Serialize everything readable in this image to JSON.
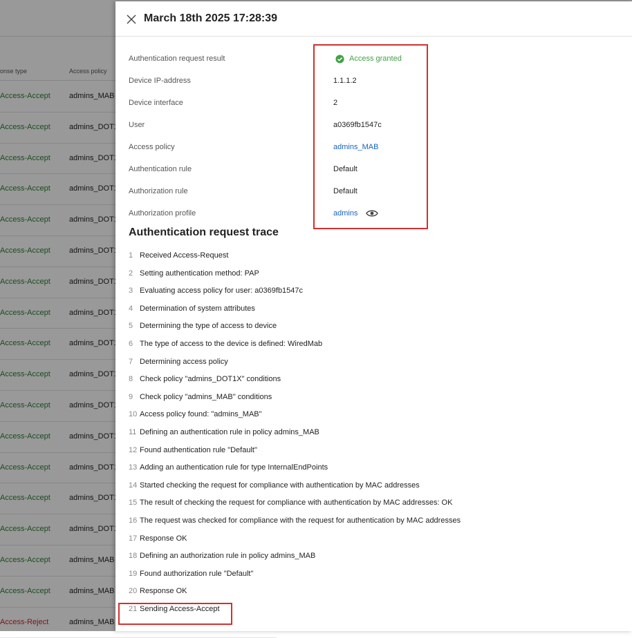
{
  "background": {
    "columns": {
      "response_type": "onse type",
      "access_policy": "Access policy"
    },
    "rows": [
      {
        "response": "Access-Accept",
        "policy": "admins_MAB",
        "status": "accept"
      },
      {
        "response": "Access-Accept",
        "policy": "admins_DOT1",
        "status": "accept"
      },
      {
        "response": "Access-Accept",
        "policy": "admins_DOT1",
        "status": "accept"
      },
      {
        "response": "Access-Accept",
        "policy": "admins_DOT1",
        "status": "accept"
      },
      {
        "response": "Access-Accept",
        "policy": "admins_DOT1",
        "status": "accept"
      },
      {
        "response": "Access-Accept",
        "policy": "admins_DOT1",
        "status": "accept"
      },
      {
        "response": "Access-Accept",
        "policy": "admins_DOT1",
        "status": "accept"
      },
      {
        "response": "Access-Accept",
        "policy": "admins_DOT1",
        "status": "accept"
      },
      {
        "response": "Access-Accept",
        "policy": "admins_DOT1",
        "status": "accept"
      },
      {
        "response": "Access-Accept",
        "policy": "admins_DOT1",
        "status": "accept"
      },
      {
        "response": "Access-Accept",
        "policy": "admins_DOT1",
        "status": "accept"
      },
      {
        "response": "Access-Accept",
        "policy": "admins_DOT1",
        "status": "accept"
      },
      {
        "response": "Access-Accept",
        "policy": "admins_DOT1",
        "status": "accept"
      },
      {
        "response": "Access-Accept",
        "policy": "admins_DOT1",
        "status": "accept"
      },
      {
        "response": "Access-Accept",
        "policy": "admins_DOT1",
        "status": "accept"
      },
      {
        "response": "Access-Accept",
        "policy": "admins_MAB",
        "status": "accept"
      },
      {
        "response": "Access-Accept",
        "policy": "admins_MAB",
        "status": "accept"
      },
      {
        "response": "Access-Reject",
        "policy": "admins_MAB",
        "status": "reject"
      }
    ]
  },
  "drawer": {
    "title": "March 18th 2025 17:28:39",
    "fields": {
      "result_label": "Authentication request result",
      "result_value": "Access granted",
      "ip_label": "Device IP-address",
      "ip_value": "1.1.1.2",
      "interface_label": "Device interface",
      "interface_value": "2",
      "user_label": "User",
      "user_value": "a0369fb1547c",
      "policy_label": "Access policy",
      "policy_value": "admins_MAB",
      "auth_rule_label": "Authentication rule",
      "auth_rule_value": "Default",
      "authz_rule_label": "Authorization rule",
      "authz_rule_value": "Default",
      "profile_label": "Authorization profile",
      "profile_value": "admins"
    },
    "trace_title": "Authentication request trace",
    "trace": [
      {
        "n": "1",
        "text": "Received Access-Request"
      },
      {
        "n": "2",
        "text": "Setting authentication method: PAP"
      },
      {
        "n": "3",
        "text": "Evaluating access policy for user: a0369fb1547c"
      },
      {
        "n": "4",
        "text": "Determination of system attributes"
      },
      {
        "n": "5",
        "text": "Determining the type of access to device"
      },
      {
        "n": "6",
        "text": "The type of access to the device is defined: WiredMab"
      },
      {
        "n": "7",
        "text": "Determining access policy"
      },
      {
        "n": "8",
        "text": "Check policy \"admins_DOT1X\" conditions"
      },
      {
        "n": "9",
        "text": "Check policy \"admins_MAB\" conditions"
      },
      {
        "n": "10",
        "text": "Access policy found: \"admins_MAB\""
      },
      {
        "n": "11",
        "text": "Defining an authentication rule in policy admins_MAB"
      },
      {
        "n": "12",
        "text": "Found authentication rule \"Default\""
      },
      {
        "n": "13",
        "text": "Adding an authentication rule for type InternalEndPoints"
      },
      {
        "n": "14",
        "text": "Started checking the request for compliance with authentication by MAC addresses"
      },
      {
        "n": "15",
        "text": "The result of checking the request for compliance with authentication by MAC addresses: OK"
      },
      {
        "n": "16",
        "text": "The request was checked for compliance with the request for authentication by MAC addresses"
      },
      {
        "n": "17",
        "text": "Response OK"
      },
      {
        "n": "18",
        "text": "Defining an authorization rule in policy admins_MAB"
      },
      {
        "n": "19",
        "text": "Found authorization rule \"Default\""
      },
      {
        "n": "20",
        "text": "Response OK"
      },
      {
        "n": "21",
        "text": "Sending Access-Accept"
      }
    ]
  },
  "colors": {
    "accept": "#2e7d32",
    "reject": "#c62828",
    "link": "#1565c0",
    "highlight": "#d32f2f"
  }
}
